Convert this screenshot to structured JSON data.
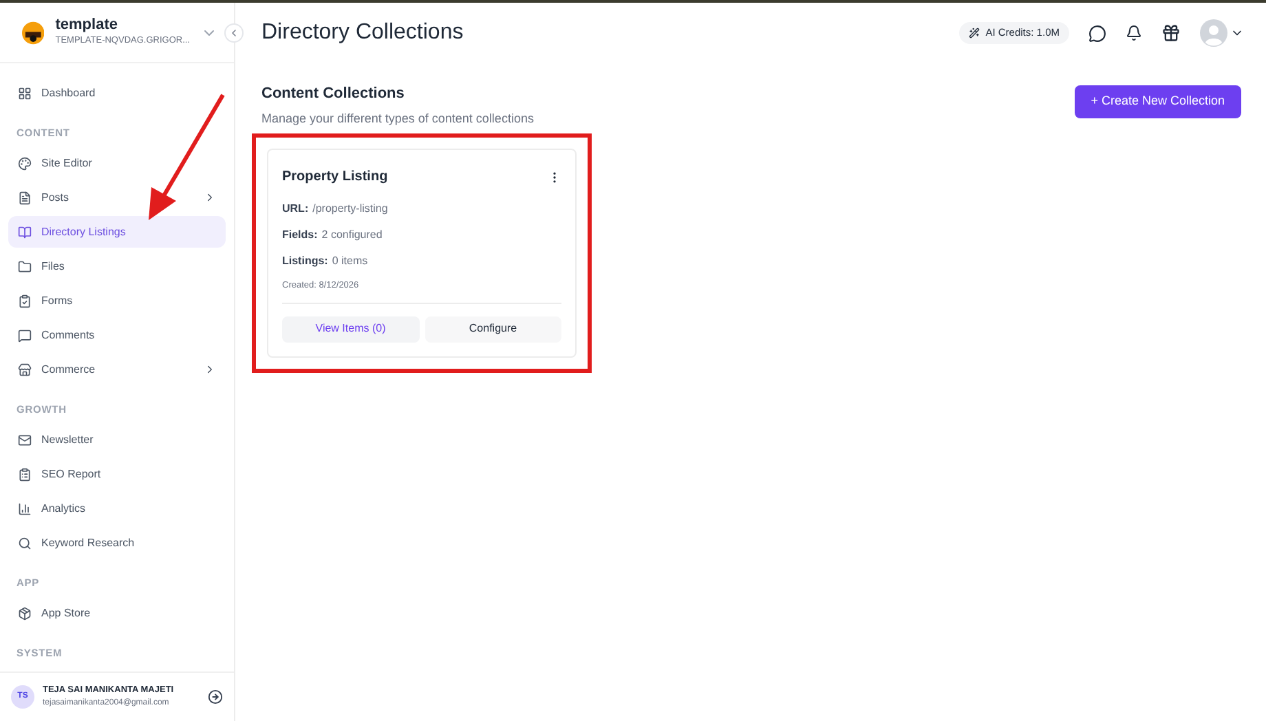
{
  "workspace": {
    "name": "template",
    "domain": "TEMPLATE-NQVDAG.GRIGOR..."
  },
  "nav": [
    {
      "kind": "item",
      "label": "Dashboard",
      "selected": false,
      "expandable": false
    },
    {
      "kind": "heading",
      "label": "CONTENT"
    },
    {
      "kind": "item",
      "label": "Site Editor",
      "selected": false,
      "expandable": false
    },
    {
      "kind": "item",
      "label": "Posts",
      "selected": false,
      "expandable": true
    },
    {
      "kind": "item",
      "label": "Directory Listings",
      "selected": true,
      "expandable": false
    },
    {
      "kind": "item",
      "label": "Files",
      "selected": false,
      "expandable": false
    },
    {
      "kind": "item",
      "label": "Forms",
      "selected": false,
      "expandable": false
    },
    {
      "kind": "item",
      "label": "Comments",
      "selected": false,
      "expandable": false
    },
    {
      "kind": "item",
      "label": "Commerce",
      "selected": false,
      "expandable": true
    },
    {
      "kind": "heading",
      "label": "GROWTH"
    },
    {
      "kind": "item",
      "label": "Newsletter",
      "selected": false,
      "expandable": false
    },
    {
      "kind": "item",
      "label": "SEO Report",
      "selected": false,
      "expandable": false
    },
    {
      "kind": "item",
      "label": "Analytics",
      "selected": false,
      "expandable": false
    },
    {
      "kind": "item",
      "label": "Keyword Research",
      "selected": false,
      "expandable": false
    },
    {
      "kind": "heading",
      "label": "APP"
    },
    {
      "kind": "item",
      "label": "App Store",
      "selected": false,
      "expandable": false
    },
    {
      "kind": "heading",
      "label": "SYSTEM"
    }
  ],
  "user": {
    "initials": "TS",
    "name": "TEJA SAI MANIKANTA MAJETI",
    "email": "tejasaimanikanta2004@gmail.com"
  },
  "page_title": "Directory Collections",
  "credits": "AI Credits: 1.0M",
  "section": {
    "title": "Content Collections",
    "subtitle": "Manage your different types of content collections",
    "create_button": "+ Create New Collection"
  },
  "collections": [
    {
      "title": "Property Listing",
      "fields": [
        {
          "label": "URL:",
          "value": "/property-listing"
        },
        {
          "label": "Fields:",
          "value": "2 configured"
        },
        {
          "label": "Listings:",
          "value": "0 items"
        }
      ],
      "created": "Created: 8/12/2026",
      "view_button": "View Items (0)",
      "configure_button": "Configure",
      "highlighted": true
    }
  ]
}
